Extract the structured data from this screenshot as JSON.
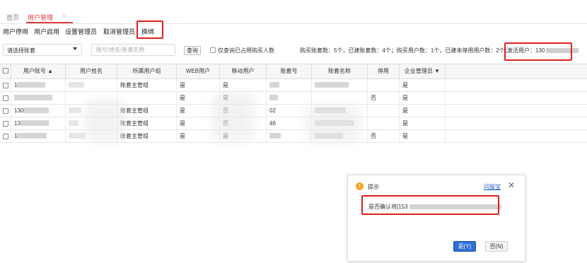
{
  "tabs": {
    "home": "首页",
    "active": "用户管理",
    "close_glyph": "×"
  },
  "toolbar": {
    "items": [
      "用户停用",
      "用户启用",
      "设置管理员",
      "取消管理员",
      "换绑"
    ]
  },
  "filter": {
    "select_value": "请选择账套",
    "search_placeholder": "账号/姓名/账套名称",
    "query_label": "查询",
    "checkbox_label": "仅查询已占用购买人数",
    "stats": "购买账套数：5个，已建账套数：4个；购买用户数：1个，已建未停用用户数：2个；",
    "activated_label": "激活用户：130"
  },
  "table": {
    "headers": [
      "用户账号 ▲",
      "用户姓名",
      "所属用户组",
      "WEB用户",
      "移动用户",
      "账套号",
      "账套名称",
      "停用",
      "企业管理员 ▼"
    ],
    "rows": [
      {
        "account": "1",
        "group": "账套主管组",
        "web": "是",
        "mobile": "是",
        "stop": "",
        "admin": "是"
      },
      {
        "account": "",
        "group": "",
        "web": "是",
        "mobile": "是",
        "stop": "否",
        "admin": "是"
      },
      {
        "account": "130",
        "group": "账套主管组",
        "web": "是",
        "mobile": "否",
        "book_no": "02",
        "stop": "",
        "admin": "是"
      },
      {
        "account": "13",
        "group": "账套主管组",
        "web": "是",
        "mobile": "否",
        "book_no": "46",
        "stop": "",
        "admin": "是"
      },
      {
        "account": "1",
        "group": "账套主管组",
        "web": "是",
        "mobile": "是",
        "stop": "否",
        "admin": "是"
      }
    ]
  },
  "dialog": {
    "title": "提示",
    "link": "问服宝",
    "close_glyph": "✕",
    "message": "是否确认将[153",
    "yes_label": "是(Y)",
    "no_label": "否(N)",
    "icon_glyph": "!"
  },
  "colors": {
    "accent_red": "#e23c3c",
    "highlight_box": "#e02020",
    "primary_button": "#2f6fd4",
    "warning": "#f5a623",
    "link": "#1e5fc4"
  }
}
